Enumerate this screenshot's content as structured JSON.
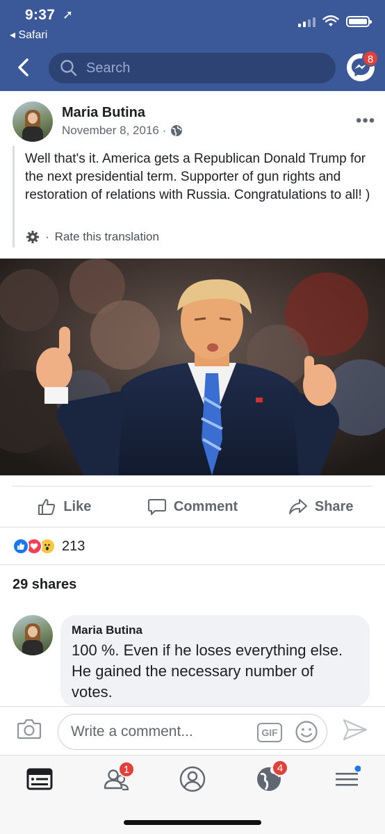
{
  "status_bar": {
    "time": "9:37",
    "back_app": "◂ Safari"
  },
  "nav": {
    "search_placeholder": "Search",
    "messenger_badge": "8"
  },
  "post": {
    "author": "Maria  Butina",
    "date": "November 8, 2016 ·",
    "text": "Well that's it. America gets a Republican Donald Trump for the next presidential term. Supporter of gun rights and restoration of relations with Russia. Congratulations to all! )",
    "translation_sep": "·",
    "translation_link": "Rate this translation",
    "more_icon": "more-dots-icon"
  },
  "actions": {
    "like": "Like",
    "comment": "Comment",
    "share": "Share"
  },
  "engagement": {
    "reaction_count": "213",
    "shares": "29 shares"
  },
  "comment": {
    "author": "Maria  Butina",
    "text": "100 %. Even if he loses everything else. He gained the necessary number of votes."
  },
  "composer": {
    "placeholder": "Write a comment...",
    "gif_label": "GIF"
  },
  "tabbar": {
    "friends_badge": "1",
    "notifications_badge": "4"
  },
  "colors": {
    "header_blue": "#3b5998",
    "badge_red": "#e0413a",
    "like_blue": "#1877f2"
  }
}
